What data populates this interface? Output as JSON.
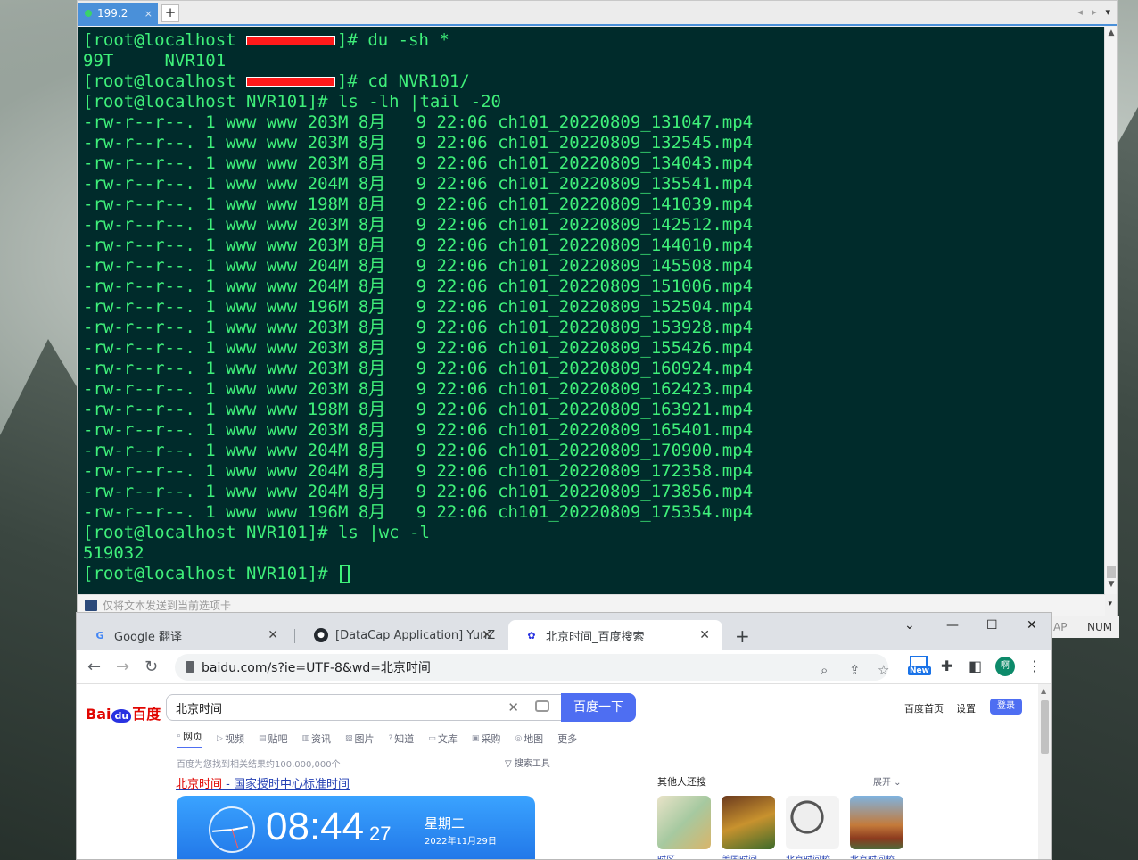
{
  "terminal": {
    "tab": {
      "label": "199.2",
      "close": "×"
    },
    "tab_add": "+",
    "lines": [
      {
        "pre": "[root@localhost ",
        "redacted": true,
        "post": "]# du -sh *"
      },
      {
        "pre": "99T     NVR101"
      },
      {
        "pre": "[root@localhost ",
        "redacted": true,
        "post": "]# cd NVR101/"
      },
      {
        "pre": "[root@localhost NVR101]# ls -lh |tail -20"
      },
      {
        "pre": "-rw-r--r--. 1 www www 203M 8月   9 22:06 ch101_20220809_131047.mp4"
      },
      {
        "pre": "-rw-r--r--. 1 www www 203M 8月   9 22:06 ch101_20220809_132545.mp4"
      },
      {
        "pre": "-rw-r--r--. 1 www www 203M 8月   9 22:06 ch101_20220809_134043.mp4"
      },
      {
        "pre": "-rw-r--r--. 1 www www 204M 8月   9 22:06 ch101_20220809_135541.mp4"
      },
      {
        "pre": "-rw-r--r--. 1 www www 198M 8月   9 22:06 ch101_20220809_141039.mp4"
      },
      {
        "pre": "-rw-r--r--. 1 www www 203M 8月   9 22:06 ch101_20220809_142512.mp4"
      },
      {
        "pre": "-rw-r--r--. 1 www www 203M 8月   9 22:06 ch101_20220809_144010.mp4"
      },
      {
        "pre": "-rw-r--r--. 1 www www 204M 8月   9 22:06 ch101_20220809_145508.mp4"
      },
      {
        "pre": "-rw-r--r--. 1 www www 204M 8月   9 22:06 ch101_20220809_151006.mp4"
      },
      {
        "pre": "-rw-r--r--. 1 www www 196M 8月   9 22:06 ch101_20220809_152504.mp4"
      },
      {
        "pre": "-rw-r--r--. 1 www www 203M 8月   9 22:06 ch101_20220809_153928.mp4"
      },
      {
        "pre": "-rw-r--r--. 1 www www 203M 8月   9 22:06 ch101_20220809_155426.mp4"
      },
      {
        "pre": "-rw-r--r--. 1 www www 203M 8月   9 22:06 ch101_20220809_160924.mp4"
      },
      {
        "pre": "-rw-r--r--. 1 www www 203M 8月   9 22:06 ch101_20220809_162423.mp4"
      },
      {
        "pre": "-rw-r--r--. 1 www www 198M 8月   9 22:06 ch101_20220809_163921.mp4"
      },
      {
        "pre": "-rw-r--r--. 1 www www 203M 8月   9 22:06 ch101_20220809_165401.mp4"
      },
      {
        "pre": "-rw-r--r--. 1 www www 204M 8月   9 22:06 ch101_20220809_170900.mp4"
      },
      {
        "pre": "-rw-r--r--. 1 www www 204M 8月   9 22:06 ch101_20220809_172358.mp4"
      },
      {
        "pre": "-rw-r--r--. 1 www www 204M 8月   9 22:06 ch101_20220809_173856.mp4"
      },
      {
        "pre": "-rw-r--r--. 1 www www 196M 8月   9 22:06 ch101_20220809_175354.mp4"
      },
      {
        "pre": "[root@localhost NVR101]# ls |wc -l"
      },
      {
        "pre": "519032"
      },
      {
        "pre": "[root@localhost NVR101]# ",
        "cursor": true
      }
    ],
    "send_bar": "仅将文本发送到当前选项卡",
    "status": {
      "cap": "AP",
      "num": "NUM"
    }
  },
  "chrome": {
    "tabs": [
      {
        "label": "Google 翻译",
        "icon": "google-translate-icon"
      },
      {
        "label": "[DataCap Application] YunZhiY",
        "icon": "github-icon"
      },
      {
        "label": "北京时间_百度搜索",
        "icon": "baidu-icon"
      }
    ],
    "new_tab": "+",
    "address": "baidu.com/s?ie=UTF-8&wd=北京时间",
    "profile_initial": "啊",
    "ext_new_label": "New"
  },
  "baidu": {
    "logo_left": "Bai",
    "logo_du": "du",
    "logo_right": "百度",
    "query": "北京时间",
    "search_button": "百度一下",
    "home": "百度首页",
    "settings": "设置",
    "login": "登录",
    "nav": [
      "网页",
      "视频",
      "贴吧",
      "资讯",
      "图片",
      "知道",
      "文库",
      "采购",
      "地图",
      "更多"
    ],
    "result_count": "百度为您找到相关结果约100,000,000个",
    "search_tools": "搜索工具",
    "result_title_kw": "北京时间",
    "result_title_rest": " - 国家授时中心标准时间",
    "clock": {
      "time": "08:44",
      "seconds": "27",
      "weekday": "星期二",
      "date": "2022年11月29日"
    },
    "others_title": "其他人还搜",
    "expand": "展开",
    "related": [
      {
        "caption": "时区"
      },
      {
        "caption": "美国时间"
      },
      {
        "caption": "北京时间校"
      },
      {
        "caption": "北京时间校"
      }
    ]
  }
}
